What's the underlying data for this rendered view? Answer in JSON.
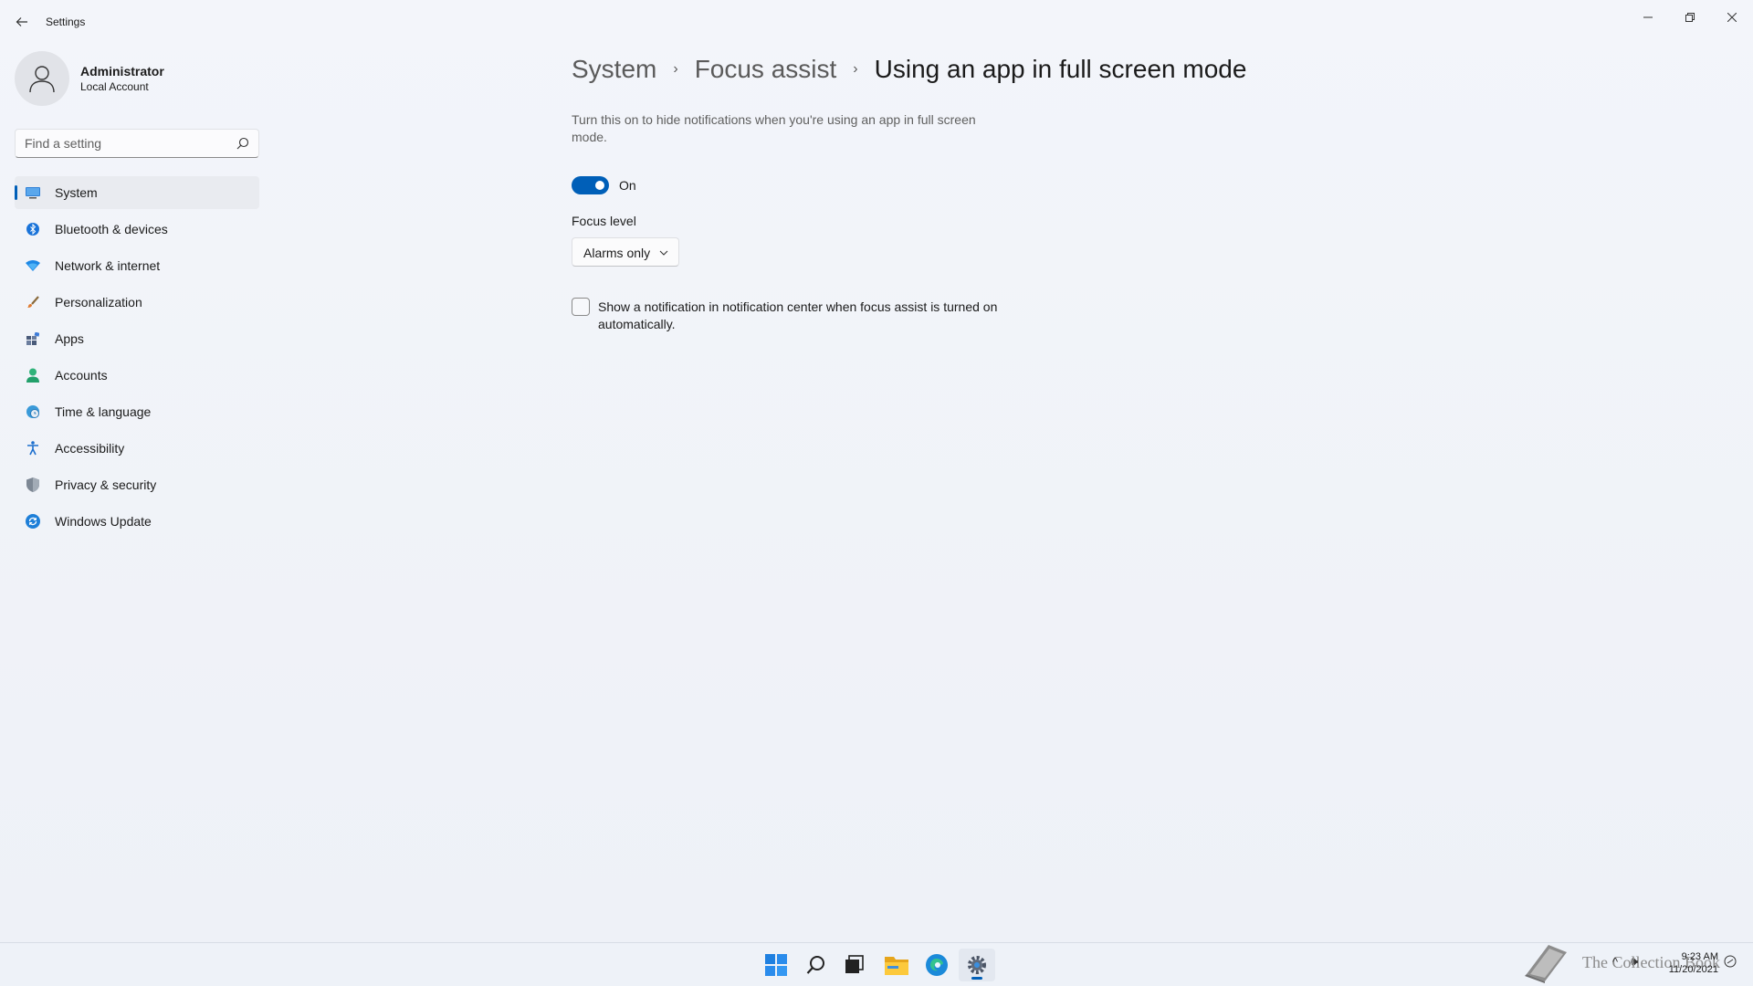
{
  "window": {
    "title": "Settings",
    "back_label": "←",
    "controls": {
      "minimize": "—",
      "maximize": "❐",
      "close": "✕"
    }
  },
  "profile": {
    "name": "Administrator",
    "account_type": "Local Account"
  },
  "search": {
    "placeholder": "Find a setting",
    "value": ""
  },
  "nav": {
    "items": [
      {
        "label": "System",
        "icon": "system-icon",
        "active": true
      },
      {
        "label": "Bluetooth & devices",
        "icon": "bluetooth-icon"
      },
      {
        "label": "Network & internet",
        "icon": "wifi-icon"
      },
      {
        "label": "Personalization",
        "icon": "brush-icon"
      },
      {
        "label": "Apps",
        "icon": "apps-icon"
      },
      {
        "label": "Accounts",
        "icon": "person-icon"
      },
      {
        "label": "Time & language",
        "icon": "globe-clock-icon"
      },
      {
        "label": "Accessibility",
        "icon": "accessibility-icon"
      },
      {
        "label": "Privacy & security",
        "icon": "shield-icon"
      },
      {
        "label": "Windows Update",
        "icon": "update-icon"
      }
    ]
  },
  "breadcrumb": {
    "items": [
      "System",
      "Focus assist"
    ],
    "current": "Using an app in full screen mode",
    "separator": "›"
  },
  "content": {
    "description": "Turn this on to hide notifications when you're using an app in full screen mode.",
    "toggle": {
      "state": "On",
      "on": true
    },
    "focus_level": {
      "label": "Focus level",
      "value": "Alarms only"
    },
    "checkbox": {
      "label": "Show a notification in notification center when focus assist is turned on automatically.",
      "checked": false
    }
  },
  "taskbar": {
    "apps": [
      "windows-start-icon",
      "search-icon",
      "task-view-icon",
      "file-explorer-icon",
      "edge-icon",
      "settings-icon"
    ],
    "active_app": "settings-icon",
    "watermark": "The Collection Book",
    "clock": {
      "time": "9:23 AM",
      "date": "11/20/2021"
    },
    "tray": {
      "overflow": "^",
      "volume": "🕪"
    }
  },
  "colors": {
    "accent": "#005fb8",
    "background": "#f1f4f9"
  }
}
